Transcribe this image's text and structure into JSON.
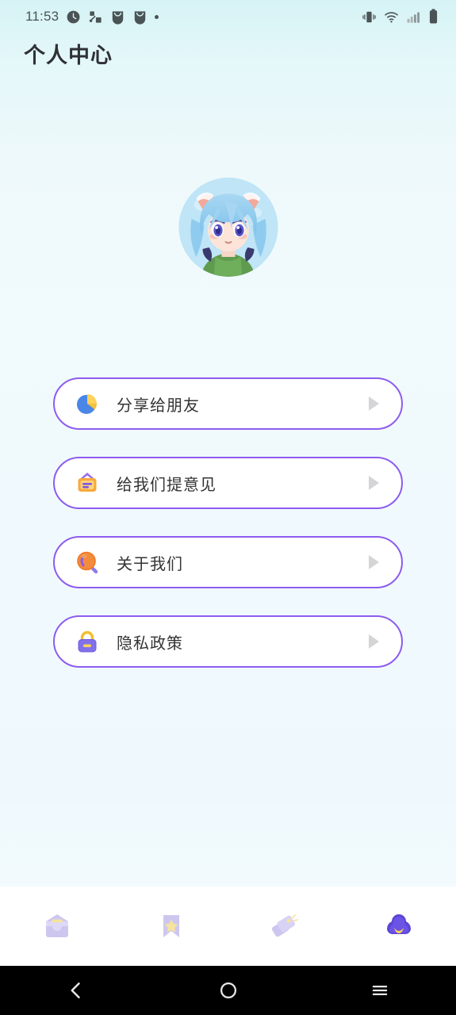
{
  "statusbar": {
    "time": "11:53",
    "left_icons": [
      "clock-icon",
      "share-nodes-icon",
      "download-bag-icon",
      "download-bag-icon-2",
      "notification-dot-icon"
    ],
    "right_icons": [
      "vibrate-icon",
      "wifi-icon",
      "cellular-signal-icon",
      "battery-icon"
    ]
  },
  "header": {
    "title": "个人中心"
  },
  "profile": {
    "avatar_name": "user-avatar-anime-character"
  },
  "menu": {
    "items": [
      {
        "label": "分享给朋友",
        "icon": "pie-share-icon",
        "name": "share-with-friends",
        "arrow": "chevron-right-icon"
      },
      {
        "label": "给我们提意见",
        "icon": "feedback-sign-icon",
        "name": "send-feedback",
        "arrow": "chevron-right-icon"
      },
      {
        "label": "关于我们",
        "icon": "magnifier-about-icon",
        "name": "about-us",
        "arrow": "chevron-right-icon"
      },
      {
        "label": "隐私政策",
        "icon": "padlock-privacy-icon",
        "name": "privacy-policy",
        "arrow": "chevron-right-icon"
      }
    ]
  },
  "tabbar": {
    "active_index": 3,
    "items": [
      {
        "icon": "inbox-box-icon",
        "name": "tab-inbox",
        "active": false
      },
      {
        "icon": "bookmark-star-icon",
        "name": "tab-favorites",
        "active": false
      },
      {
        "icon": "price-tags-icon",
        "name": "tab-tags",
        "active": false
      },
      {
        "icon": "cloud-profile-icon",
        "name": "tab-profile",
        "active": true
      }
    ]
  },
  "systemnav": {
    "back": "back-chevron-icon",
    "home": "home-circle-icon",
    "recents": "recents-menu-icon"
  },
  "colors": {
    "accent_purple": "#8d5cf0",
    "card_bg": "#ffffff",
    "text_primary": "#343434",
    "bg_top": "#d6f3f5",
    "bg_bottom": "#f0f9fd",
    "tab_inactive": "#cdc7f0",
    "tab_active": "#5b45d6",
    "arrow_gray": "#d5d5d8"
  }
}
